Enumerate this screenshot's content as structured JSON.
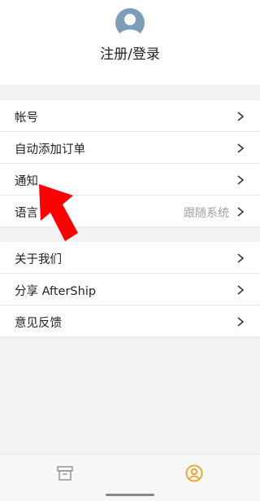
{
  "header": {
    "login_title": "注册/登录"
  },
  "settings": {
    "group1": [
      {
        "label": "帐号",
        "value": ""
      },
      {
        "label": "自动添加订单",
        "value": ""
      },
      {
        "label": "通知",
        "value": ""
      },
      {
        "label": "语言",
        "value": "跟随系统"
      }
    ],
    "group2": [
      {
        "label": "关于我们",
        "value": ""
      },
      {
        "label": "分享 AfterShip",
        "value": ""
      },
      {
        "label": "意见反馈",
        "value": ""
      }
    ]
  },
  "icons": {
    "avatar": "user-avatar-icon",
    "chevron": "chevron-right-icon",
    "tab_orders": "archive-box-icon",
    "tab_profile": "user-circle-icon",
    "annotation": "red-arrow-icon"
  },
  "colors": {
    "accent": "#f0a020",
    "annotation_arrow": "#ff0000",
    "avatar_bg": "#7f9cb8"
  }
}
